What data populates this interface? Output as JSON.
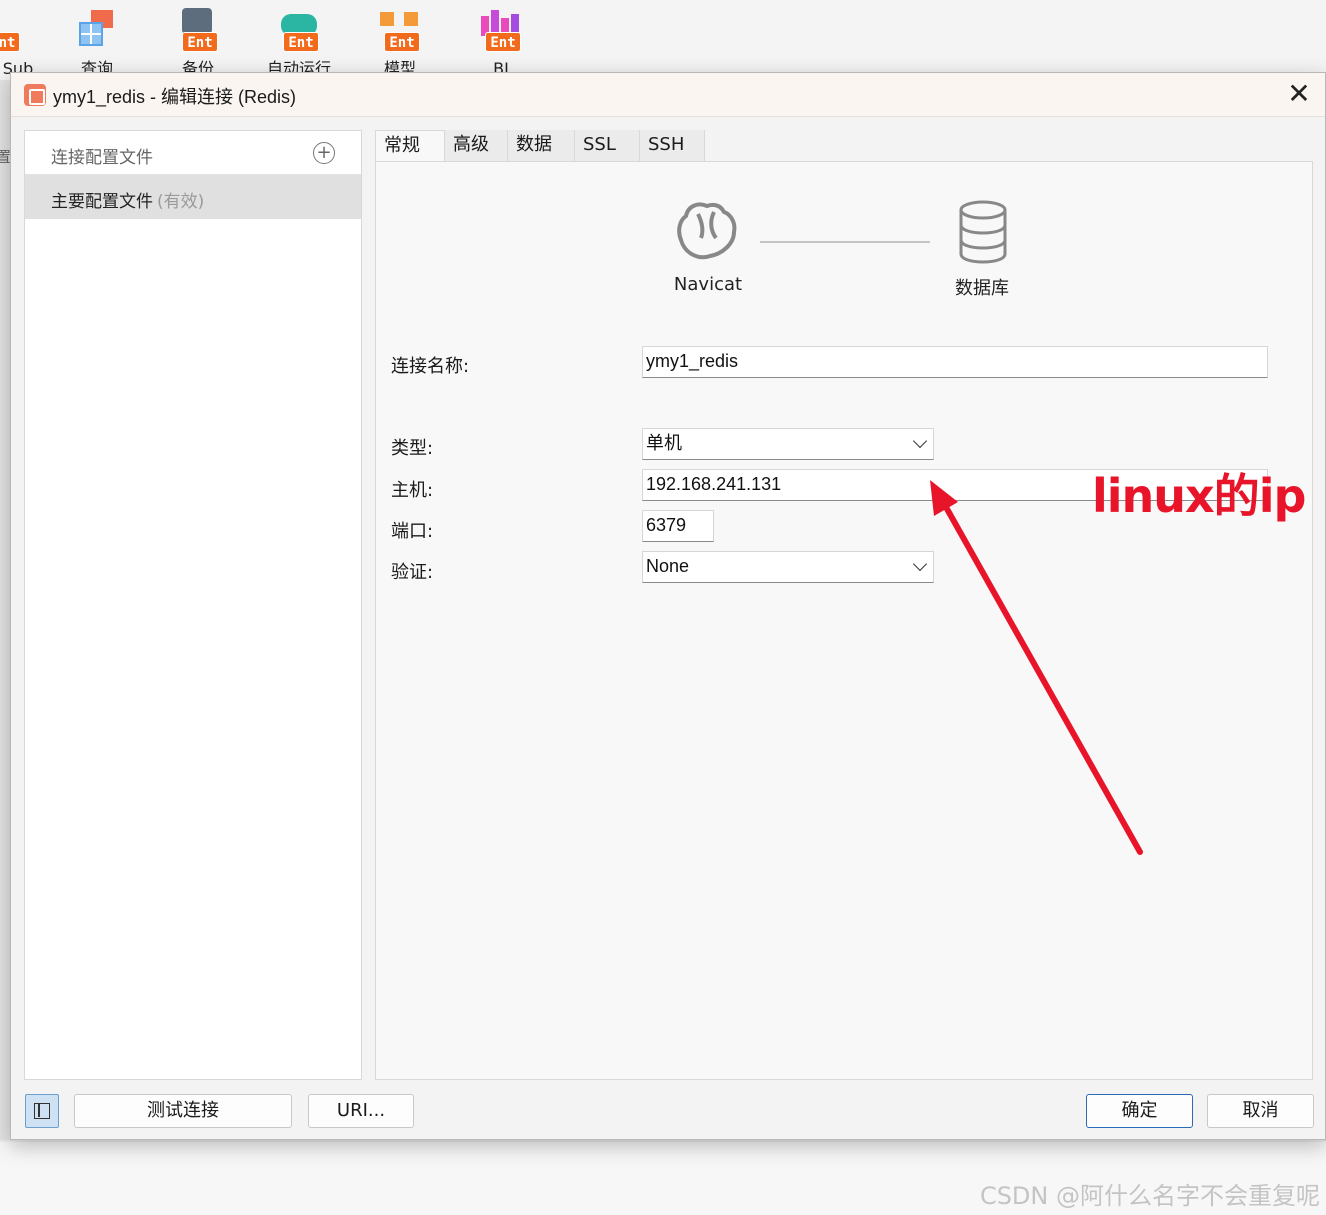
{
  "toolbar": {
    "items": [
      {
        "label": "Sub",
        "badge": "nt",
        "icon": "pubsub-icon"
      },
      {
        "label": "查询",
        "badge": "",
        "icon": "query-icon"
      },
      {
        "label": "备份",
        "badge": "Ent",
        "icon": "backup-icon"
      },
      {
        "label": "自动运行",
        "badge": "Ent",
        "icon": "automation-icon"
      },
      {
        "label": "模型",
        "badge": "Ent",
        "icon": "model-icon"
      },
      {
        "label": "BI",
        "badge": "Ent",
        "icon": "bi-icon"
      }
    ]
  },
  "background": {
    "left_strip_text": "置"
  },
  "dialog": {
    "title": "ymy1_redis - 编辑连接 (Redis)",
    "close_symbol": "✕",
    "profiles": {
      "header": "连接配置文件",
      "add_symbol": "+",
      "items": [
        {
          "label": "主要配置文件",
          "status": "(有效)"
        }
      ]
    },
    "tabs": [
      "常规",
      "高级",
      "数据库",
      "SSL",
      "SSH"
    ],
    "active_tab": "常规",
    "diagram": {
      "left_label": "Navicat",
      "right_label": "数据库"
    },
    "form": {
      "connection_name_label": "连接名称:",
      "connection_name_value": "ymy1_redis",
      "type_label": "类型:",
      "type_value": "单机",
      "host_label": "主机:",
      "host_value": "192.168.241.131",
      "port_label": "端口:",
      "port_value": "6379",
      "auth_label": "验证:",
      "auth_value": "None"
    },
    "buttons": {
      "test": "测试连接",
      "uri": "URI...",
      "ok": "确定",
      "cancel": "取消"
    }
  },
  "annotation": {
    "text": "linux的ip",
    "color": "#e8152a"
  },
  "watermark": "CSDN @阿什么名字不会重复呢"
}
